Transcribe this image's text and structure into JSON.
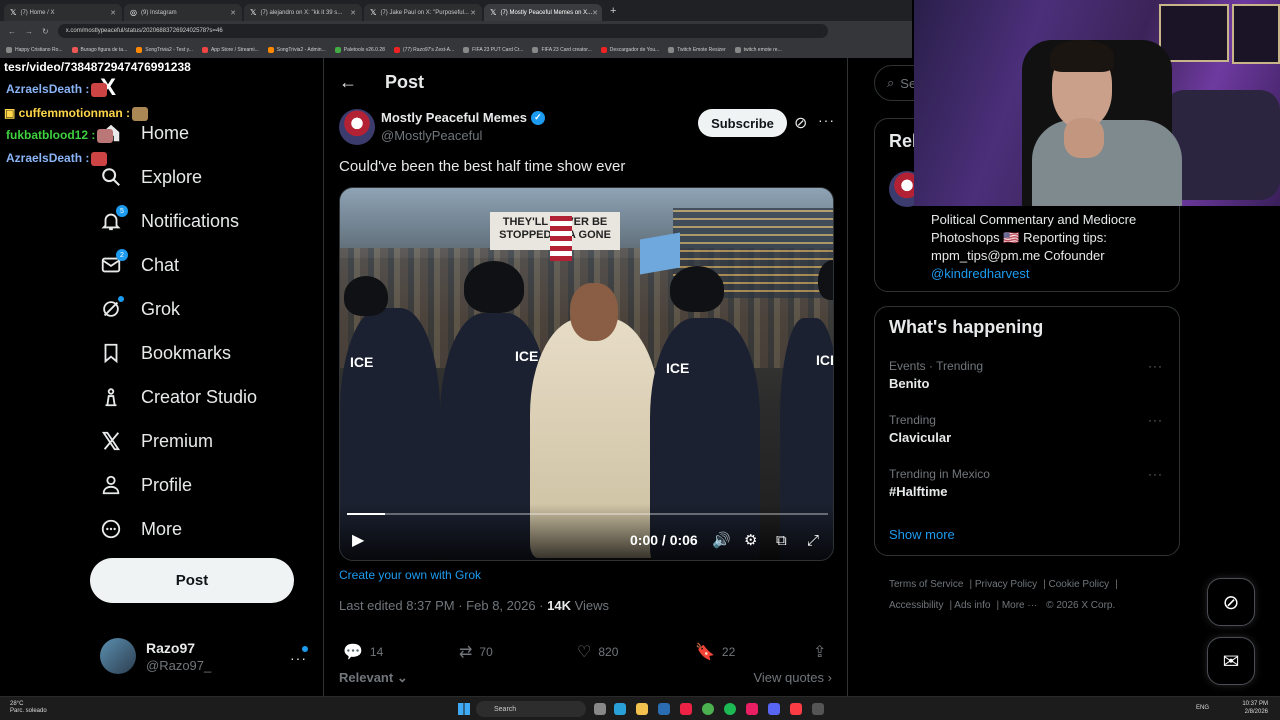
{
  "browser": {
    "tabs": [
      {
        "label": "(7) Home / X",
        "active": false
      },
      {
        "label": "(9) Instagram",
        "active": false
      },
      {
        "label": "(7) alejandro on X: \"kk it 39 s...",
        "active": false
      },
      {
        "label": "(7) Jake Paul on X: \"Purposeful...",
        "active": false
      },
      {
        "label": "(7) Mostly Peaceful Memes on X...",
        "active": true
      }
    ],
    "new_tab": "+",
    "url": "x.com/mostlypeaceful/status/2020688372692402578?s=46",
    "bookmarks": [
      "Happy Cristiano Ro...",
      "Burago figura de ta...",
      "SongTrivia2 - Test y...",
      "App Store / Streami...",
      "SongTrivia2 - Admin...",
      "Paletools v26.0.28",
      "(77) Razo97's Zest-A...",
      "FIFA 23 PUT Card Cr...",
      "FIFA 23 Card creator...",
      "Descargador de You...",
      "Twitch Emote Resizer",
      "twitch emote re..."
    ]
  },
  "chat_overlay": [
    {
      "user": "tesr/video/7384872947476991238",
      "color": "#ffffff"
    },
    {
      "user": "AzraelsDeath :",
      "color": "#8ab4f8"
    },
    {
      "user": "cuffemmotionman :",
      "color": "#ffd54a"
    },
    {
      "user": "fukbatblood12 :",
      "color": "#3fd13f"
    },
    {
      "user": "AzraelsDeath :",
      "color": "#8ab4f8"
    }
  ],
  "nav": {
    "logo": "X",
    "items": [
      {
        "label": "Home",
        "icon": "home-icon",
        "glyph": "⌂",
        "badge": ""
      },
      {
        "label": "Explore",
        "icon": "search-icon",
        "glyph": "⌕",
        "badge": ""
      },
      {
        "label": "Notifications",
        "icon": "bell-icon",
        "glyph": "🔔",
        "badge": "5"
      },
      {
        "label": "Chat",
        "icon": "mail-icon",
        "glyph": "✉",
        "badge": "2"
      },
      {
        "label": "Grok",
        "icon": "grok-icon",
        "glyph": "⊘",
        "badge": ""
      },
      {
        "label": "Bookmarks",
        "icon": "bookmark-icon",
        "glyph": "🔖",
        "badge": ""
      },
      {
        "label": "Creator Studio",
        "icon": "creator-studio-icon",
        "glyph": "♙",
        "badge": ""
      },
      {
        "label": "Premium",
        "icon": "x-premium-icon",
        "glyph": "𝕏",
        "badge": ""
      },
      {
        "label": "Profile",
        "icon": "person-icon",
        "glyph": "👤",
        "badge": ""
      },
      {
        "label": "More",
        "icon": "more-circle-icon",
        "glyph": "⋯",
        "badge": ""
      }
    ],
    "post_button": "Post",
    "account": {
      "name": "Razo97",
      "handle": "@Razo97_",
      "more": "···"
    }
  },
  "post": {
    "header_title": "Post",
    "author_name": "Mostly Peaceful Memes",
    "author_handle": "@MostlyPeaceful",
    "subscribe": "Subscribe",
    "text": "Could've been the best half time show ever",
    "video": {
      "sign_text": "THEY'LL NEVER BE STOPPED FLA GONE",
      "ice_labels": [
        "ICE",
        "ICE",
        "ICE",
        "ICE"
      ],
      "time": "0:00 / 0:06",
      "progress_fraction": 0.08
    },
    "grok_link": "Create your own with Grok",
    "meta_edited": "Last edited 8:37 PM · Feb 8, 2026 · ",
    "meta_views_count": "14K",
    "meta_views_label": " Views",
    "actions": {
      "replies": "14",
      "reposts": "70",
      "likes": "820",
      "bookmarks": "22"
    },
    "relevant": "Relevant",
    "view_quotes": "View quotes"
  },
  "sidebar": {
    "search_placeholder": "Se",
    "relevant_title": "Rel",
    "bio": "Political Commentary and Mediocre Photoshops 🇺🇸 Reporting tips: mpm_tips@pm.me Cofounder",
    "bio_link": "@kindredharvest",
    "happening_title": "What's happening",
    "trends": [
      {
        "category": "Events · Trending",
        "name": "Benito"
      },
      {
        "category": "Trending",
        "name": "Clavicular"
      },
      {
        "category": "Trending in Mexico",
        "name": "#Halftime"
      }
    ],
    "show_more": "Show more",
    "footer": [
      "Terms of Service",
      "Privacy Policy",
      "Cookie Policy",
      "Accessibility",
      "Ads info",
      "More ···",
      "© 2026 X Corp."
    ]
  },
  "taskbar": {
    "weather_temp": "28°C",
    "weather_desc": "Parc. soleado",
    "search": "Search",
    "lang": "ENG",
    "time": "10:37 PM",
    "date": "2/8/2026"
  }
}
